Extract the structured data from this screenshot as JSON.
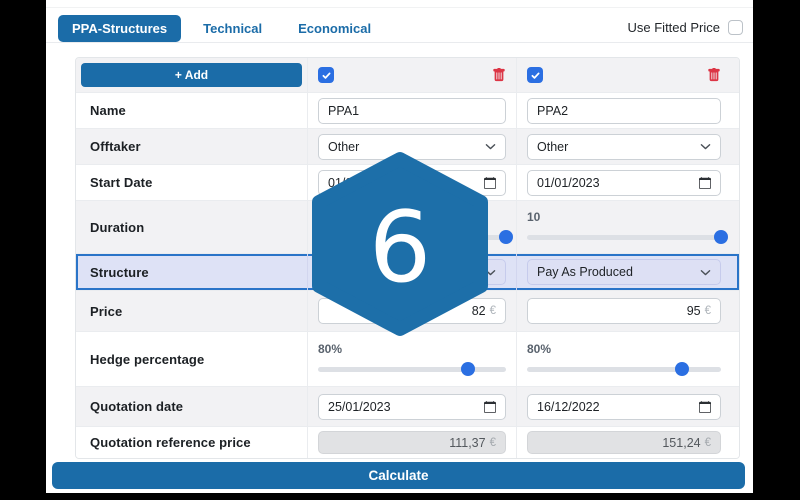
{
  "tabs": [
    {
      "label": "PPA-Structures",
      "active": true
    },
    {
      "label": "Technical",
      "active": false
    },
    {
      "label": "Economical",
      "active": false
    }
  ],
  "header": {
    "use_fitted_price_label": "Use Fitted Price",
    "use_fitted_price_checked": false
  },
  "table": {
    "add_button_label": "+ Add",
    "currency_symbol": "€",
    "row_labels": {
      "name": "Name",
      "offtaker": "Offtaker",
      "start_date": "Start Date",
      "duration": "Duration",
      "structure": "Structure",
      "price": "Price",
      "hedge": "Hedge percentage",
      "quotation_date": "Quotation date",
      "quotation_reference_price": "Quotation reference price"
    },
    "ppa1": {
      "selected": true,
      "name": "PPA1",
      "offtaker": "Other",
      "start_date": "01/0",
      "duration_label": "",
      "duration_percent": 100,
      "structure": "",
      "price": "82",
      "hedge_label": "80%",
      "hedge_percent": 80,
      "quotation_date": "25/01/2023",
      "quotation_reference_price": "111,37"
    },
    "ppa2": {
      "selected": true,
      "name": "PPA2",
      "offtaker": "Other",
      "start_date": "01/01/2023",
      "duration_label": "10",
      "duration_percent": 100,
      "structure": "Pay As Produced",
      "price": "95",
      "hedge_label": "80%",
      "hedge_percent": 80,
      "quotation_date": "16/12/2022",
      "quotation_reference_price": "151,24"
    }
  },
  "overlay": {
    "badge_number": "6"
  },
  "footer": {
    "calculate_label": "Calculate"
  },
  "icons": {
    "add": "plus",
    "delete": "trash-icon",
    "select": "chevron-down-icon",
    "date": "calendar-icon",
    "selected": "checkmark-icon"
  },
  "colors": {
    "primary_blue": "#1b6ca8",
    "checkbox_blue": "#2b6fe2",
    "slider_blue": "#2b6fe2",
    "danger_red": "#dc3545",
    "highlight_bg": "#dee2f6",
    "highlight_border": "#2a74c8",
    "row_alt_bg": "#f2f2f4",
    "disabled_bg": "#e1e2e4"
  }
}
